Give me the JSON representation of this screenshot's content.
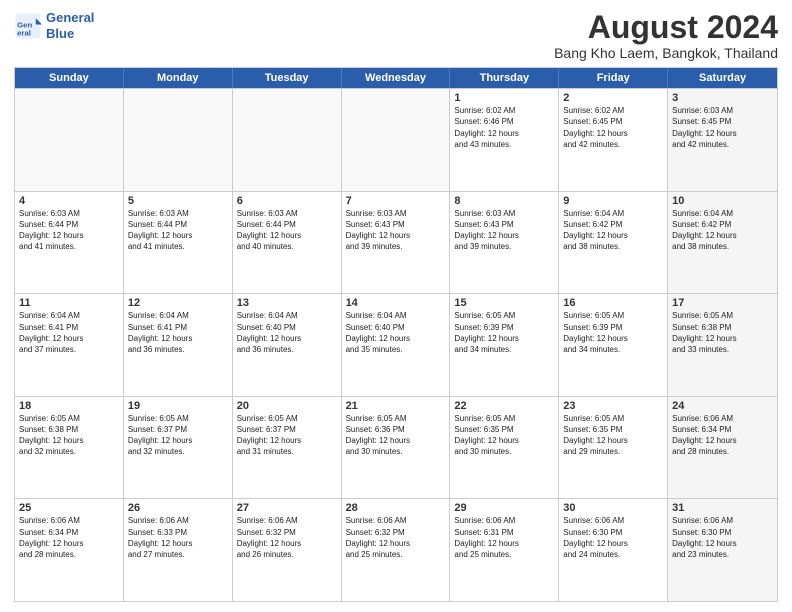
{
  "header": {
    "logo_line1": "General",
    "logo_line2": "Blue",
    "title": "August 2024",
    "subtitle": "Bang Kho Laem, Bangkok, Thailand"
  },
  "calendar": {
    "days_of_week": [
      "Sunday",
      "Monday",
      "Tuesday",
      "Wednesday",
      "Thursday",
      "Friday",
      "Saturday"
    ],
    "rows": [
      [
        {
          "day": "",
          "info": "",
          "empty": true
        },
        {
          "day": "",
          "info": "",
          "empty": true
        },
        {
          "day": "",
          "info": "",
          "empty": true
        },
        {
          "day": "",
          "info": "",
          "empty": true
        },
        {
          "day": "1",
          "info": "Sunrise: 6:02 AM\nSunset: 6:46 PM\nDaylight: 12 hours\nand 43 minutes.",
          "empty": false
        },
        {
          "day": "2",
          "info": "Sunrise: 6:02 AM\nSunset: 6:45 PM\nDaylight: 12 hours\nand 42 minutes.",
          "empty": false
        },
        {
          "day": "3",
          "info": "Sunrise: 6:03 AM\nSunset: 6:45 PM\nDaylight: 12 hours\nand 42 minutes.",
          "empty": false,
          "shaded": true
        }
      ],
      [
        {
          "day": "4",
          "info": "Sunrise: 6:03 AM\nSunset: 6:44 PM\nDaylight: 12 hours\nand 41 minutes.",
          "empty": false
        },
        {
          "day": "5",
          "info": "Sunrise: 6:03 AM\nSunset: 6:44 PM\nDaylight: 12 hours\nand 41 minutes.",
          "empty": false
        },
        {
          "day": "6",
          "info": "Sunrise: 6:03 AM\nSunset: 6:44 PM\nDaylight: 12 hours\nand 40 minutes.",
          "empty": false
        },
        {
          "day": "7",
          "info": "Sunrise: 6:03 AM\nSunset: 6:43 PM\nDaylight: 12 hours\nand 39 minutes.",
          "empty": false
        },
        {
          "day": "8",
          "info": "Sunrise: 6:03 AM\nSunset: 6:43 PM\nDaylight: 12 hours\nand 39 minutes.",
          "empty": false
        },
        {
          "day": "9",
          "info": "Sunrise: 6:04 AM\nSunset: 6:42 PM\nDaylight: 12 hours\nand 38 minutes.",
          "empty": false
        },
        {
          "day": "10",
          "info": "Sunrise: 6:04 AM\nSunset: 6:42 PM\nDaylight: 12 hours\nand 38 minutes.",
          "empty": false,
          "shaded": true
        }
      ],
      [
        {
          "day": "11",
          "info": "Sunrise: 6:04 AM\nSunset: 6:41 PM\nDaylight: 12 hours\nand 37 minutes.",
          "empty": false
        },
        {
          "day": "12",
          "info": "Sunrise: 6:04 AM\nSunset: 6:41 PM\nDaylight: 12 hours\nand 36 minutes.",
          "empty": false
        },
        {
          "day": "13",
          "info": "Sunrise: 6:04 AM\nSunset: 6:40 PM\nDaylight: 12 hours\nand 36 minutes.",
          "empty": false
        },
        {
          "day": "14",
          "info": "Sunrise: 6:04 AM\nSunset: 6:40 PM\nDaylight: 12 hours\nand 35 minutes.",
          "empty": false
        },
        {
          "day": "15",
          "info": "Sunrise: 6:05 AM\nSunset: 6:39 PM\nDaylight: 12 hours\nand 34 minutes.",
          "empty": false
        },
        {
          "day": "16",
          "info": "Sunrise: 6:05 AM\nSunset: 6:39 PM\nDaylight: 12 hours\nand 34 minutes.",
          "empty": false
        },
        {
          "day": "17",
          "info": "Sunrise: 6:05 AM\nSunset: 6:38 PM\nDaylight: 12 hours\nand 33 minutes.",
          "empty": false,
          "shaded": true
        }
      ],
      [
        {
          "day": "18",
          "info": "Sunrise: 6:05 AM\nSunset: 6:38 PM\nDaylight: 12 hours\nand 32 minutes.",
          "empty": false
        },
        {
          "day": "19",
          "info": "Sunrise: 6:05 AM\nSunset: 6:37 PM\nDaylight: 12 hours\nand 32 minutes.",
          "empty": false
        },
        {
          "day": "20",
          "info": "Sunrise: 6:05 AM\nSunset: 6:37 PM\nDaylight: 12 hours\nand 31 minutes.",
          "empty": false
        },
        {
          "day": "21",
          "info": "Sunrise: 6:05 AM\nSunset: 6:36 PM\nDaylight: 12 hours\nand 30 minutes.",
          "empty": false
        },
        {
          "day": "22",
          "info": "Sunrise: 6:05 AM\nSunset: 6:35 PM\nDaylight: 12 hours\nand 30 minutes.",
          "empty": false
        },
        {
          "day": "23",
          "info": "Sunrise: 6:05 AM\nSunset: 6:35 PM\nDaylight: 12 hours\nand 29 minutes.",
          "empty": false
        },
        {
          "day": "24",
          "info": "Sunrise: 6:06 AM\nSunset: 6:34 PM\nDaylight: 12 hours\nand 28 minutes.",
          "empty": false,
          "shaded": true
        }
      ],
      [
        {
          "day": "25",
          "info": "Sunrise: 6:06 AM\nSunset: 6:34 PM\nDaylight: 12 hours\nand 28 minutes.",
          "empty": false
        },
        {
          "day": "26",
          "info": "Sunrise: 6:06 AM\nSunset: 6:33 PM\nDaylight: 12 hours\nand 27 minutes.",
          "empty": false
        },
        {
          "day": "27",
          "info": "Sunrise: 6:06 AM\nSunset: 6:32 PM\nDaylight: 12 hours\nand 26 minutes.",
          "empty": false
        },
        {
          "day": "28",
          "info": "Sunrise: 6:06 AM\nSunset: 6:32 PM\nDaylight: 12 hours\nand 25 minutes.",
          "empty": false
        },
        {
          "day": "29",
          "info": "Sunrise: 6:06 AM\nSunset: 6:31 PM\nDaylight: 12 hours\nand 25 minutes.",
          "empty": false
        },
        {
          "day": "30",
          "info": "Sunrise: 6:06 AM\nSunset: 6:30 PM\nDaylight: 12 hours\nand 24 minutes.",
          "empty": false
        },
        {
          "day": "31",
          "info": "Sunrise: 6:06 AM\nSunset: 6:30 PM\nDaylight: 12 hours\nand 23 minutes.",
          "empty": false,
          "shaded": true
        }
      ]
    ]
  }
}
